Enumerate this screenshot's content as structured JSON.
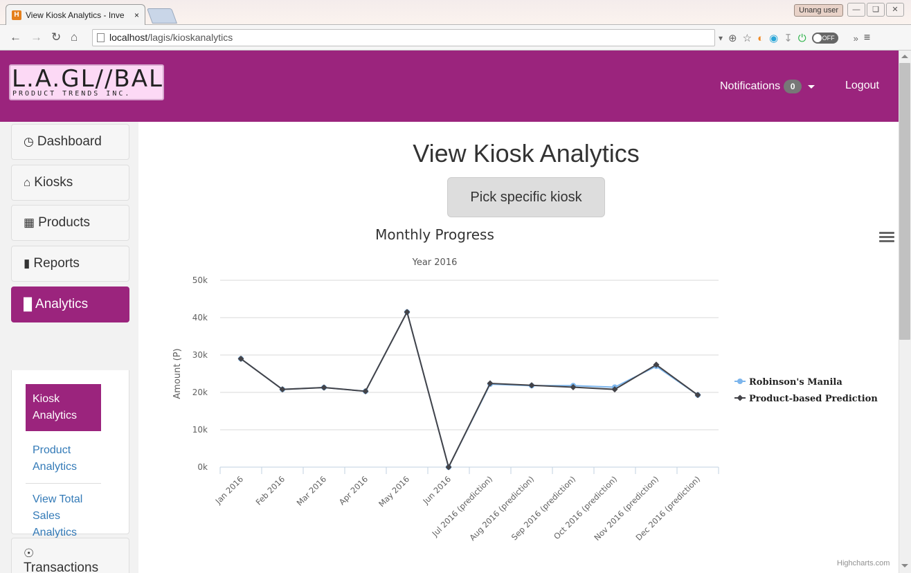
{
  "browser": {
    "tab_title": "View Kiosk Analytics - Inve",
    "tab_close": "×",
    "url_host": "localhost",
    "url_path": "/lagis/kioskanalytics",
    "user_label": "Unang user"
  },
  "header": {
    "logo_main": "L.A.GL∕∕BAL",
    "logo_sub": "PRODUCT TRENDS INC.",
    "notifications_label": "Notifications",
    "notifications_count": "0",
    "logout_label": "Logout"
  },
  "sidebar": {
    "items": [
      {
        "label": "Dashboard"
      },
      {
        "label": "Kiosks"
      },
      {
        "label": "Products"
      },
      {
        "label": "Reports"
      },
      {
        "label": "Analytics"
      },
      {
        "label": "Transactions"
      }
    ],
    "sub_items": [
      {
        "label": "Kiosk Analytics"
      },
      {
        "label": "Product Analytics"
      },
      {
        "label": "View Total Sales Analytics"
      }
    ]
  },
  "main": {
    "title": "View Kiosk Analytics",
    "pick_button": "Pick specific kiosk",
    "credit": "Highcharts.com"
  },
  "colors": {
    "brand": "#9b247d",
    "series1": "#7cb5ec",
    "series2": "#434348"
  },
  "chart_data": {
    "type": "line",
    "title": "Monthly Progress",
    "subtitle": "Year 2016",
    "ylabel": "Amount (P)",
    "xlabel": "",
    "ylim": [
      0,
      50000
    ],
    "yticks": [
      "0k",
      "10k",
      "20k",
      "30k",
      "40k",
      "50k"
    ],
    "legend_position": "right",
    "categories": [
      "Jan 2016",
      "Feb 2016",
      "Mar 2016",
      "Apr 2016",
      "May 2016",
      "Jun 2016",
      "Jul 2016 (prediction)",
      "Aug 2016 (prediction)",
      "Sep 2016 (prediction)",
      "Oct 2016 (prediction)",
      "Nov 2016 (prediction)",
      "Dec 2016 (prediction)"
    ],
    "series": [
      {
        "name": "Robinson's Manila",
        "color": "#7cb5ec",
        "values": [
          29000,
          20800,
          21300,
          20300,
          41500,
          0,
          22200,
          21800,
          21800,
          21400,
          27000,
          19300
        ]
      },
      {
        "name": "Product-based Prediction",
        "color": "#434348",
        "values": [
          29000,
          20800,
          21300,
          20300,
          41500,
          0,
          22400,
          21900,
          21400,
          20800,
          27400,
          19300
        ]
      }
    ],
    "grid": true
  }
}
